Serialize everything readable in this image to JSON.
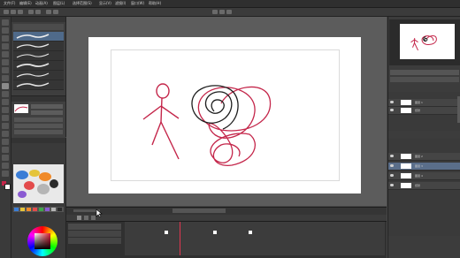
{
  "menubar": {
    "items": [
      "文件(F)",
      "编辑(E)",
      "动画(A)",
      "图层(L)",
      "选择范围(S)",
      "显示(V)",
      "滤镜(I)",
      "窗口(W)",
      "帮助(H)"
    ]
  },
  "layers": {
    "group_a": [
      "图层 1",
      "纸张"
    ],
    "group_b": [
      "图层 2",
      "图层 3",
      "图层 4",
      "纸张"
    ]
  },
  "colors": {
    "stroke_red": "#c4264a",
    "stroke_dark": "#1e1e1e",
    "palette": [
      "#3a7dd6",
      "#e5c43a",
      "#f08a2a",
      "#e34b4b",
      "#3ea84a",
      "#8a5bd2",
      "#b5b5b5",
      "#2b2b2b"
    ]
  },
  "icons": {
    "cursor": "arrow-cursor-icon",
    "play": "play-icon",
    "color_wheel": "color-wheel-icon"
  }
}
